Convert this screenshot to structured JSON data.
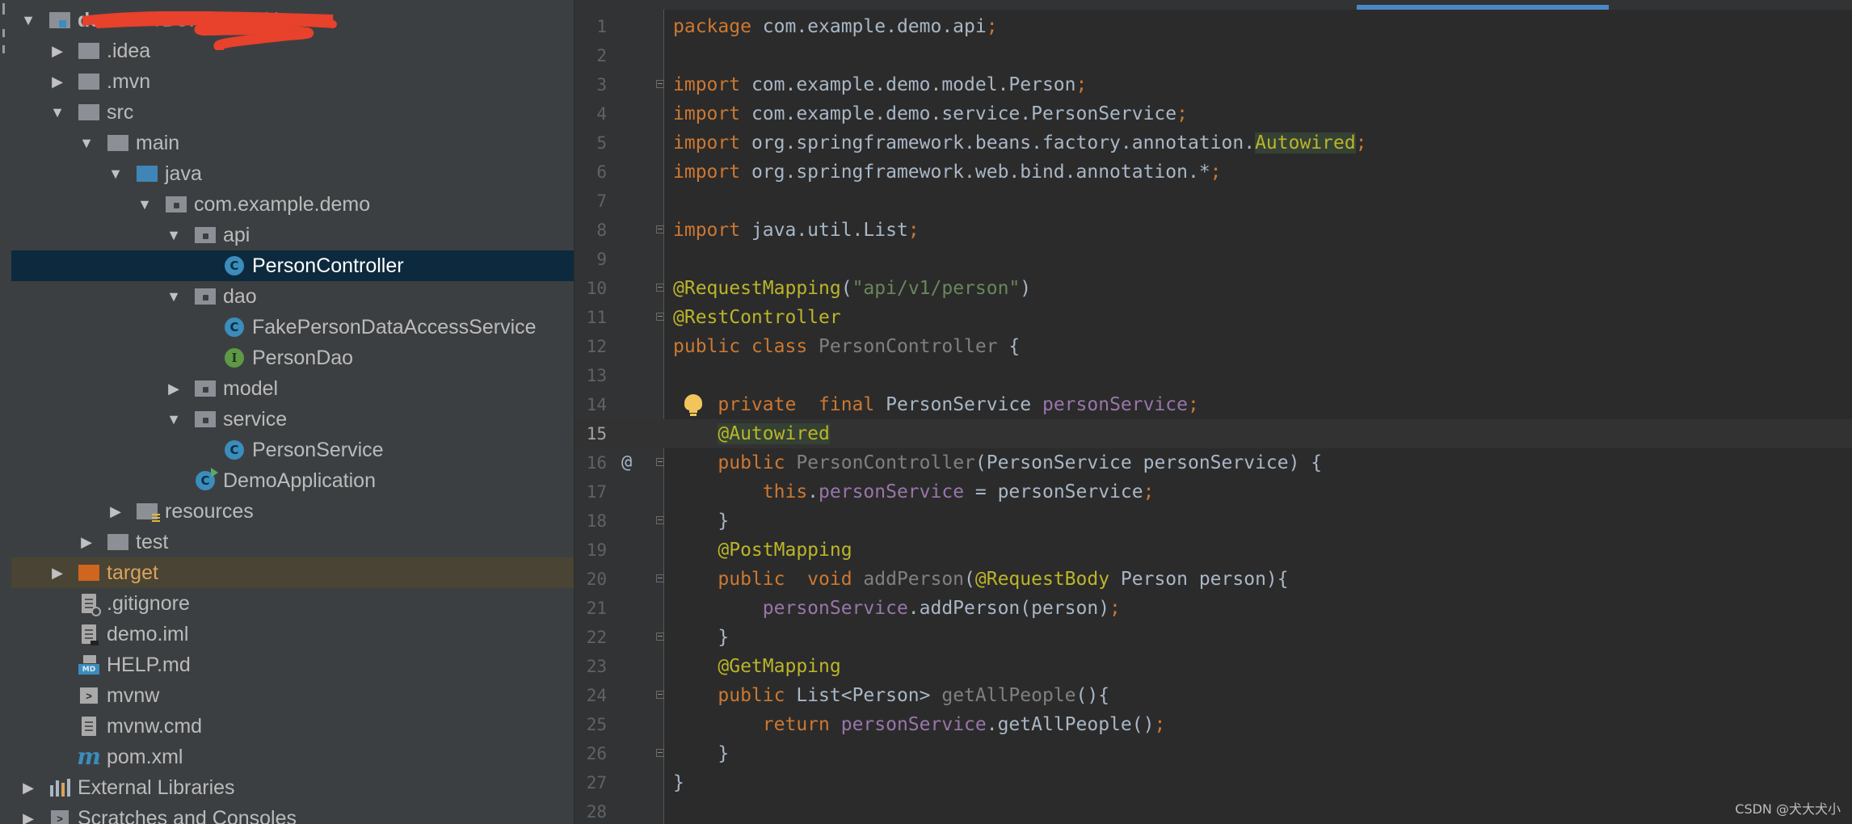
{
  "project_tree": {
    "rows": [
      {
        "label": "demo",
        "suffix": "~/Downloads/demo",
        "arrow": "open",
        "icon": "module-folder-icon"
      },
      {
        "label": ".idea",
        "arrow": "closed",
        "icon": "folder-icon"
      },
      {
        "label": ".mvn",
        "arrow": "closed",
        "icon": "folder-icon"
      },
      {
        "label": "src",
        "arrow": "open",
        "icon": "folder-icon"
      },
      {
        "label": "main",
        "arrow": "open",
        "icon": "folder-icon"
      },
      {
        "label": "java",
        "arrow": "open",
        "icon": "source-root-folder-icon"
      },
      {
        "label": "com.example.demo",
        "arrow": "open",
        "icon": "package-icon"
      },
      {
        "label": "api",
        "arrow": "open",
        "icon": "package-icon"
      },
      {
        "label": "PersonController",
        "arrow": "none",
        "icon": "class-icon",
        "selected": true
      },
      {
        "label": "dao",
        "arrow": "open",
        "icon": "package-icon"
      },
      {
        "label": "FakePersonDataAccessService",
        "arrow": "none",
        "icon": "class-icon"
      },
      {
        "label": "PersonDao",
        "arrow": "none",
        "icon": "interface-icon"
      },
      {
        "label": "model",
        "arrow": "closed",
        "icon": "package-icon"
      },
      {
        "label": "service",
        "arrow": "open",
        "icon": "package-icon"
      },
      {
        "label": "PersonService",
        "arrow": "none",
        "icon": "class-icon"
      },
      {
        "label": "DemoApplication",
        "arrow": "none",
        "icon": "spring-boot-class-icon"
      },
      {
        "label": "resources",
        "arrow": "closed",
        "icon": "resources-folder-icon"
      },
      {
        "label": "test",
        "arrow": "closed",
        "icon": "folder-icon"
      },
      {
        "label": "target",
        "arrow": "closed",
        "icon": "excluded-folder-icon",
        "excluded": true
      },
      {
        "label": ".gitignore",
        "arrow": "none",
        "icon": "gitignore-file-icon"
      },
      {
        "label": "demo.iml",
        "arrow": "none",
        "icon": "iml-file-icon"
      },
      {
        "label": "HELP.md",
        "arrow": "none",
        "icon": "markdown-file-icon"
      },
      {
        "label": "mvnw",
        "arrow": "none",
        "icon": "shell-script-icon"
      },
      {
        "label": "mvnw.cmd",
        "arrow": "none",
        "icon": "text-file-icon"
      },
      {
        "label": "pom.xml",
        "arrow": "none",
        "icon": "maven-pom-icon"
      },
      {
        "label": "External Libraries",
        "arrow": "closed",
        "icon": "libraries-icon"
      },
      {
        "label": "Scratches and Consoles",
        "arrow": "closed",
        "icon": "scratches-icon"
      }
    ]
  },
  "editor": {
    "current_line": 15,
    "lines": [
      {
        "n": "1",
        "tokens": [
          {
            "t": "package ",
            "c": "kw"
          },
          {
            "t": "com.example.demo.api"
          },
          {
            "t": ";",
            "c": "kw"
          }
        ]
      },
      {
        "n": "2",
        "tokens": []
      },
      {
        "n": "3",
        "fold": true,
        "tokens": [
          {
            "t": "import ",
            "c": "kw"
          },
          {
            "t": "com.example.demo.model.Person"
          },
          {
            "t": ";",
            "c": "kw"
          }
        ]
      },
      {
        "n": "4",
        "tokens": [
          {
            "t": "import ",
            "c": "kw"
          },
          {
            "t": "com.example.demo.service.PersonService"
          },
          {
            "t": ";",
            "c": "kw"
          }
        ]
      },
      {
        "n": "5",
        "tokens": [
          {
            "t": "import ",
            "c": "kw"
          },
          {
            "t": "org.springframework.beans.factory.annotation."
          },
          {
            "t": "Autowired",
            "c": "ann hl-usage"
          },
          {
            "t": ";",
            "c": "kw"
          }
        ]
      },
      {
        "n": "6",
        "tokens": [
          {
            "t": "import ",
            "c": "kw"
          },
          {
            "t": "org.springframework.web.bind.annotation.*"
          },
          {
            "t": ";",
            "c": "kw"
          }
        ]
      },
      {
        "n": "7",
        "tokens": []
      },
      {
        "n": "8",
        "fold": true,
        "tokens": [
          {
            "t": "import ",
            "c": "kw"
          },
          {
            "t": "java.util.List"
          },
          {
            "t": ";",
            "c": "kw"
          }
        ]
      },
      {
        "n": "9",
        "tokens": []
      },
      {
        "n": "10",
        "fold": true,
        "tokens": [
          {
            "t": "@RequestMapping",
            "c": "ann"
          },
          {
            "t": "("
          },
          {
            "t": "\"api/v1/person\"",
            "c": "str"
          },
          {
            "t": ")"
          }
        ]
      },
      {
        "n": "11",
        "fold": true,
        "tokens": [
          {
            "t": "@RestController",
            "c": "ann"
          }
        ]
      },
      {
        "n": "12",
        "tokens": [
          {
            "t": "public class ",
            "c": "kw"
          },
          {
            "t": "PersonController",
            "c": "unused"
          },
          {
            "t": " {"
          }
        ]
      },
      {
        "n": "13",
        "tokens": []
      },
      {
        "n": "14",
        "bulb": true,
        "tokens": [
          {
            "t": "    "
          },
          {
            "t": "private  final ",
            "c": "kw"
          },
          {
            "t": "PersonService "
          },
          {
            "t": "personService",
            "c": "fld"
          },
          {
            "t": ";",
            "c": "kw"
          }
        ]
      },
      {
        "n": "15",
        "tokens": [
          {
            "t": "    "
          },
          {
            "t": "@Autowired",
            "c": "ann hl-usage"
          }
        ]
      },
      {
        "n": "16",
        "fold": true,
        "at": true,
        "tokens": [
          {
            "t": "    "
          },
          {
            "t": "public ",
            "c": "kw"
          },
          {
            "t": "PersonController",
            "c": "unused"
          },
          {
            "t": "(PersonService personService) {"
          }
        ]
      },
      {
        "n": "17",
        "tokens": [
          {
            "t": "        "
          },
          {
            "t": "this",
            "c": "kw"
          },
          {
            "t": "."
          },
          {
            "t": "personService",
            "c": "fld"
          },
          {
            "t": " = personService"
          },
          {
            "t": ";",
            "c": "kw"
          }
        ]
      },
      {
        "n": "18",
        "fold": true,
        "tokens": [
          {
            "t": "    }"
          }
        ]
      },
      {
        "n": "19",
        "tokens": [
          {
            "t": "    "
          },
          {
            "t": "@PostMapping",
            "c": "ann"
          }
        ]
      },
      {
        "n": "20",
        "fold": true,
        "tokens": [
          {
            "t": "    "
          },
          {
            "t": "public  void ",
            "c": "kw"
          },
          {
            "t": "addPerson",
            "c": "unused"
          },
          {
            "t": "("
          },
          {
            "t": "@RequestBody",
            "c": "ann"
          },
          {
            "t": " Person person){"
          }
        ]
      },
      {
        "n": "21",
        "tokens": [
          {
            "t": "        "
          },
          {
            "t": "personService",
            "c": "fld"
          },
          {
            "t": ".addPerson(person)"
          },
          {
            "t": ";",
            "c": "kw"
          }
        ]
      },
      {
        "n": "22",
        "fold": true,
        "tokens": [
          {
            "t": "    }"
          }
        ]
      },
      {
        "n": "23",
        "tokens": [
          {
            "t": "    "
          },
          {
            "t": "@GetMapping",
            "c": "ann"
          }
        ]
      },
      {
        "n": "24",
        "fold": true,
        "tokens": [
          {
            "t": "    "
          },
          {
            "t": "public ",
            "c": "kw"
          },
          {
            "t": "List<Person> "
          },
          {
            "t": "getAllPeople",
            "c": "unused"
          },
          {
            "t": "(){"
          }
        ]
      },
      {
        "n": "25",
        "tokens": [
          {
            "t": "        "
          },
          {
            "t": "return ",
            "c": "kw"
          },
          {
            "t": "personService",
            "c": "fld"
          },
          {
            "t": ".getAllPeople()"
          },
          {
            "t": ";",
            "c": "kw"
          }
        ]
      },
      {
        "n": "26",
        "fold": true,
        "tokens": [
          {
            "t": "    }"
          }
        ]
      },
      {
        "n": "27",
        "tokens": [
          {
            "t": "}"
          }
        ]
      },
      {
        "n": "28",
        "tokens": []
      }
    ]
  },
  "watermark": "CSDN @犬大犬小",
  "colors": {
    "keyword": "#cc7832",
    "annotation": "#bbb529",
    "string": "#6a8759",
    "field": "#9876aa",
    "selection": "#0d293e",
    "excluded_row": "#4a4434"
  }
}
